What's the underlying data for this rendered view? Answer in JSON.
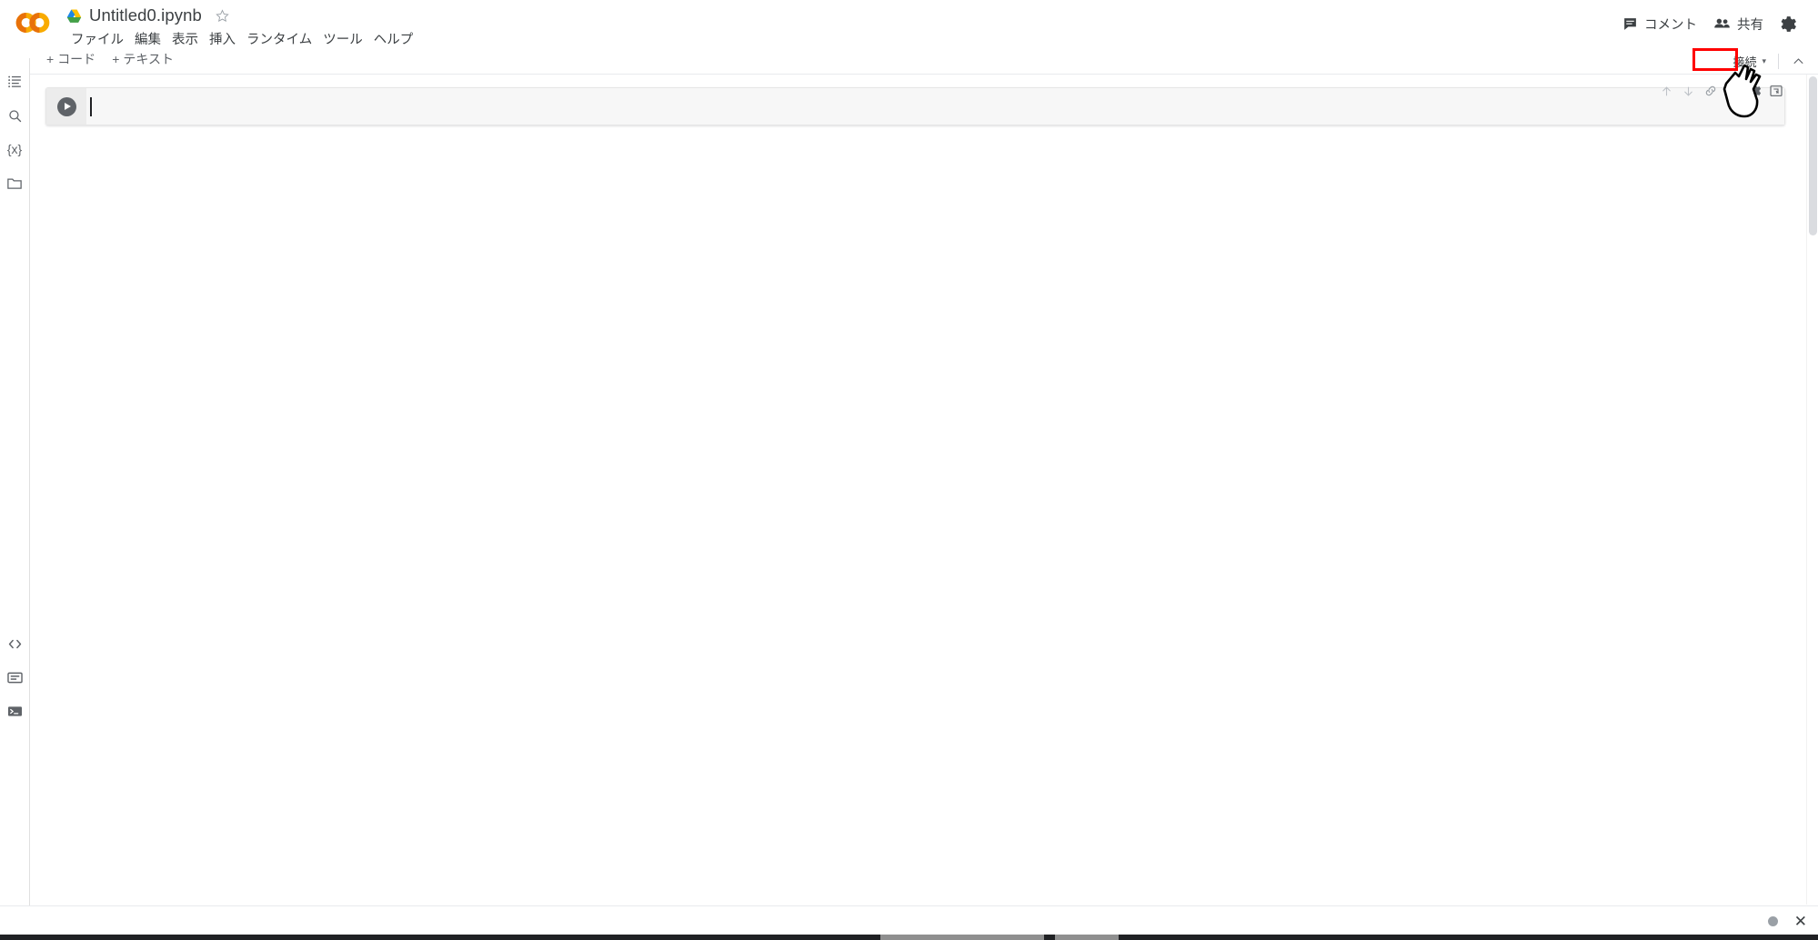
{
  "app": {
    "name": "Google Colaboratory",
    "logo_text": "CO",
    "logo_color": "#f9ab00"
  },
  "header": {
    "drive_icon": "drive-icon",
    "doc_title": "Untitled0.ipynb",
    "star_icon": "star-outline-icon",
    "menu_items": [
      {
        "label": "ファイル",
        "name": "menu-file"
      },
      {
        "label": "編集",
        "name": "menu-edit"
      },
      {
        "label": "表示",
        "name": "menu-view"
      },
      {
        "label": "挿入",
        "name": "menu-insert"
      },
      {
        "label": "ランタイム",
        "name": "menu-runtime"
      },
      {
        "label": "ツール",
        "name": "menu-tools"
      },
      {
        "label": "ヘルプ",
        "name": "menu-help"
      }
    ],
    "right_actions": [
      {
        "label": "コメント",
        "icon": "comment-icon",
        "name": "comment-button"
      },
      {
        "label": "共有",
        "icon": "people-icon",
        "name": "share-button"
      }
    ],
    "settings_icon": "gear-icon"
  },
  "rail": {
    "top_items": [
      {
        "icon": "table-of-contents-icon",
        "name": "rail-toc",
        "glyph": "toc"
      },
      {
        "icon": "search-icon",
        "name": "rail-search",
        "glyph": "search"
      },
      {
        "icon": "variables-icon",
        "name": "rail-variables",
        "glyph": "{x}"
      },
      {
        "icon": "folder-icon",
        "name": "rail-files",
        "glyph": "folder"
      }
    ],
    "bottom_items": [
      {
        "icon": "code-snippets-icon",
        "name": "rail-code-snippets",
        "glyph": "<>"
      },
      {
        "icon": "command-palette-icon",
        "name": "rail-command-palette",
        "glyph": "palette"
      },
      {
        "icon": "terminal-icon",
        "name": "rail-terminal",
        "glyph": "terminal"
      }
    ]
  },
  "toolbar": {
    "add_code_plus": "+",
    "add_code_label": "コード",
    "add_text_plus": "+",
    "add_text_label": "テキスト",
    "connect_label": "接続",
    "connect_caret": "▾",
    "collapse_icon": "chevron-up-icon",
    "highlight_color": "#ff0000"
  },
  "notebook": {
    "cell": {
      "run_icon": "run-play-icon",
      "code": "",
      "cell_actions": [
        {
          "icon": "move-cell-up-icon",
          "name": "cell-move-up"
        },
        {
          "icon": "move-cell-down-icon",
          "name": "cell-move-down"
        },
        {
          "icon": "link-to-cell-icon",
          "name": "cell-link"
        },
        {
          "icon": "add-comment-icon",
          "name": "cell-comment"
        },
        {
          "icon": "cell-settings-icon",
          "name": "cell-settings"
        },
        {
          "icon": "mirror-cell-icon",
          "name": "cell-mirror"
        }
      ]
    }
  },
  "status_bar": {
    "status_dot": "idle-status-dot",
    "close_icon": "close-icon",
    "close_glyph": "✕"
  },
  "cursor": {
    "type": "pointing-hand-cursor"
  }
}
